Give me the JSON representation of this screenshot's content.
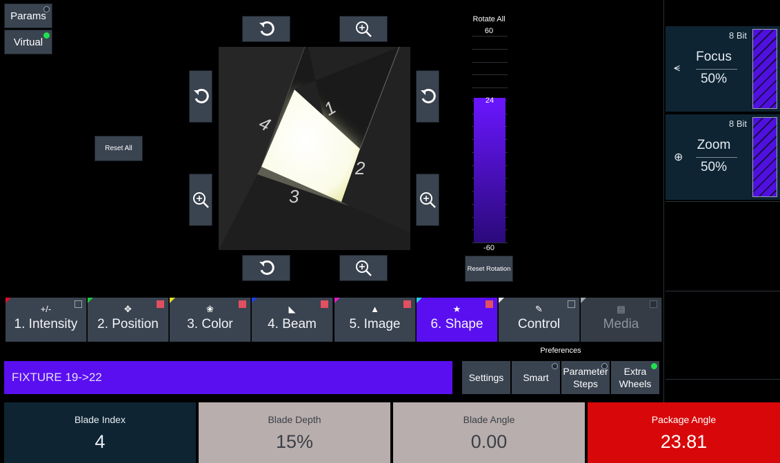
{
  "top_left": {
    "params_label": "Params",
    "virtual_label": "Virtual"
  },
  "reset_all_label": "Reset All",
  "blades": {
    "labels": [
      "1",
      "2",
      "3",
      "4"
    ]
  },
  "rotate": {
    "title": "Rotate All",
    "max": "60",
    "min": "-60",
    "current": "24",
    "reset_label": "Reset Rotation",
    "level_fraction": 0.7
  },
  "encoders": [
    {
      "bits": "8 Bit",
      "name": "Focus",
      "value": "50%",
      "icon": "focus-icon"
    },
    {
      "bits": "8 Bit",
      "name": "Zoom",
      "value": "50%",
      "icon": "zoom-icon"
    }
  ],
  "tabs": [
    {
      "label": "1. Intensity",
      "glyph": "+/-",
      "corner": "#e0102a"
    },
    {
      "label": "2. Position",
      "glyph": "✥",
      "corner": "#1ec840"
    },
    {
      "label": "3. Color",
      "glyph": "❀",
      "corner": "#e8e020"
    },
    {
      "label": "4. Beam",
      "glyph": "◣",
      "corner": "#2040e8"
    },
    {
      "label": "5. Image",
      "glyph": "▲",
      "corner": "#e020c8"
    },
    {
      "label": "6. Shape",
      "glyph": "★",
      "corner": "#20d0e8"
    },
    {
      "label": "Control",
      "glyph": "✎",
      "corner": "#e8e8e8"
    },
    {
      "label": "Media",
      "glyph": "▤",
      "corner": "#a0a8b0"
    }
  ],
  "preferences": {
    "title": "Preferences",
    "settings": "Settings",
    "smart": "Smart",
    "parameter_steps_1": "Parameter",
    "parameter_steps_2": "Steps",
    "extra_wheels_1": "Extra",
    "extra_wheels_2": "Wheels"
  },
  "fixture_label": "FIXTURE 19->22",
  "cards": [
    {
      "title": "Blade Index",
      "value": "4"
    },
    {
      "title": "Blade Depth",
      "value": "15%"
    },
    {
      "title": "Blade Angle",
      "value": "0.00"
    },
    {
      "title": "Package Angle",
      "value": "23.81"
    }
  ],
  "colors": {
    "accent": "#5a0ff0",
    "active_red": "#d8080a",
    "card_grey": "#b8aeae",
    "card_dark": "#0e2433"
  }
}
